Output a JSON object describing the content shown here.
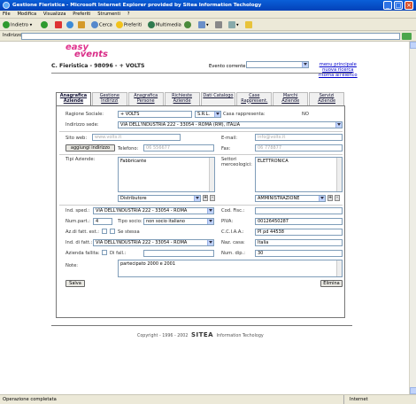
{
  "window": {
    "title": "Gestione Fieristica - Microsoft Internet Explorer provided by Sitea Information Techology"
  },
  "menu": [
    "File",
    "Modifica",
    "Visualizza",
    "Preferiti",
    "Strumenti",
    "?"
  ],
  "toolbar": {
    "back": "Indietro",
    "search": "Cerca",
    "favorites": "Preferiti",
    "multimedia": "Multimedia"
  },
  "address": {
    "label": "Indirizzo"
  },
  "logo": {
    "line1": "easy",
    "line2": "events"
  },
  "page": {
    "title": "C. Fieristica - 98096 - + VOLTS",
    "event_label": "Evento corrente:",
    "event_value": "*Evento 2002"
  },
  "links": [
    "menu principale",
    "nuova ricerca",
    "ritorna all'elenco"
  ],
  "tabs": [
    {
      "label": "Anagrafica Aziende",
      "active": true
    },
    {
      "label": "Gestione Indirizzi",
      "active": false
    },
    {
      "label": "Anagrafica Persone",
      "active": false
    },
    {
      "label": "Richieste Aziende",
      "active": false
    },
    {
      "label": "Dati Catalogo",
      "active": false
    },
    {
      "label": "Case Rappresent.",
      "active": false
    },
    {
      "label": "Marchi Aziende",
      "active": false
    },
    {
      "label": "Servizi Aziende",
      "active": false
    }
  ],
  "form": {
    "ragione_label": "Ragione Sociale:",
    "ragione_value": "+ VOLTS",
    "forma_value": "S.R.L.",
    "casa_label": "Casa rappresenta:",
    "casa_value": "NO",
    "sede_label": "Indirizzo sede:",
    "sede_value": "VIA DELL'INDUSTRIA 222 - 33054 - ROMA (RM), ITALIA",
    "web_label": "Sito web:",
    "web_value": "www.volts.it",
    "email_label": "E-mail:",
    "email_value": "info@volts.it",
    "agg_button": "aggiungi indirizzo",
    "tel_label": "Telefono:",
    "tel_value": "06 556677",
    "fax_label": "Fax:",
    "fax_value": "06 778877",
    "tipo_label": "Tipi Aziende:",
    "tipo_text": "Fabbricante",
    "settori_label": "Settori merceologici:",
    "settori_text": "ELETTRONICA",
    "tipo_select": "Distributore",
    "settori_select": "AMMINISTRAZIONE",
    "spedi_label": "Ind. sped.:",
    "spedi_value": "VIA DELL'INDUSTRIA 222 - 33054 - ROMA",
    "codfisc_label": "Cod. Fisc.:",
    "codfisc_value": "",
    "numpart_label": "Num.part.:",
    "numpart_value": "4",
    "tiposocio_label": "Tipo socio:",
    "tiposocio_value": "non socio italiano",
    "piva_label": "PIVA:",
    "piva_value": "00126450287",
    "azfatt_label": "Az.di fatt. est.:",
    "stessa_label": "Se stessa",
    "cciaa_label": "C.C.I.A.A.:",
    "cciaa_value": "PI pd 44538",
    "fatt_label": "Ind. di fatt.:",
    "fatt_value": "VIA DELL'INDUSTRIA 222 - 33054 - ROMA",
    "naz_label": "Naz. casa:",
    "naz_value": "Italia",
    "fallita_label": "Azienda fallita:",
    "difall_label": "Di fall.:",
    "difall_value": "",
    "numdip_label": "Num. dip.:",
    "numdip_value": "30",
    "note_label": "Note:",
    "note_value": "partecipato 2000 e 2001",
    "save_button": "Salva",
    "delete_button": "Elimina"
  },
  "footer": {
    "copyright": "Copyright - 1996 - 2002",
    "brand": "SITEA",
    "tagline": "Information Techology"
  },
  "status": {
    "left": "Operazione completata",
    "right": "Internet"
  }
}
